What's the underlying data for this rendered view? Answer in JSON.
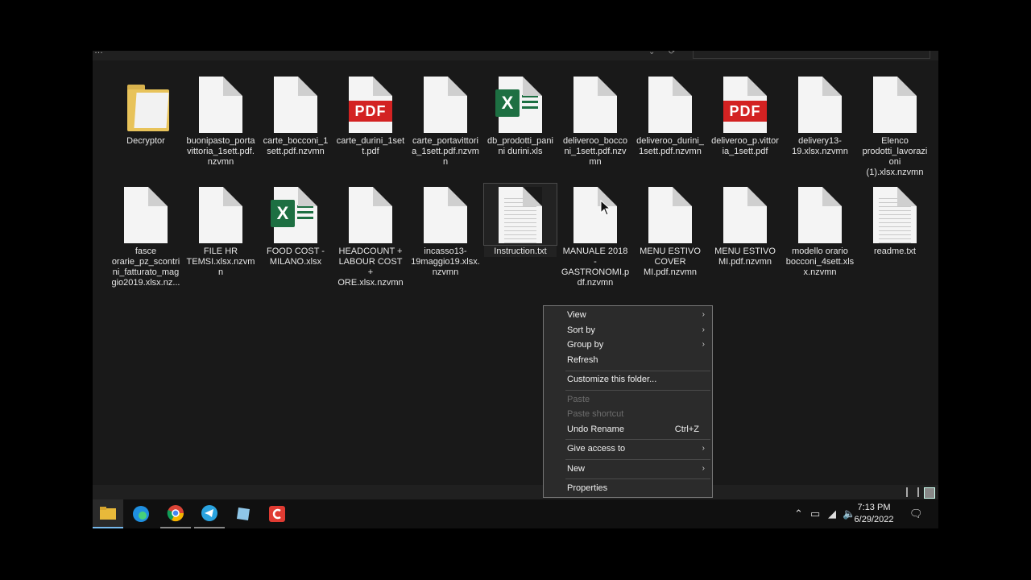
{
  "topbar": {
    "crumb": "…",
    "search_placeholder": "…"
  },
  "files": [
    {
      "name": "Decryptor",
      "kind": "folder"
    },
    {
      "name": "buonipasto_portavittoria_1sett.pdf.nzvmn",
      "kind": "blank"
    },
    {
      "name": "carte_bocconi_1sett.pdf.nzvmn",
      "kind": "blank"
    },
    {
      "name": "carte_durini_1sett.pdf",
      "kind": "pdf"
    },
    {
      "name": "carte_portavittoria_1sett.pdf.nzvmn",
      "kind": "blank"
    },
    {
      "name": "db_prodotti_panini durini.xls",
      "kind": "xls"
    },
    {
      "name": "deliveroo_bocconi_1sett.pdf.nzvmn",
      "kind": "blank"
    },
    {
      "name": "deliveroo_durini_1sett.pdf.nzvmn",
      "kind": "blank"
    },
    {
      "name": "deliveroo_p.vittoria_1sett.pdf",
      "kind": "pdf"
    },
    {
      "name": "delivery13-19.xlsx.nzvmn",
      "kind": "blank"
    },
    {
      "name": "Elenco prodotti_lavorazioni (1).xlsx.nzvmn",
      "kind": "blank"
    },
    {
      "name": "fasce orarie_pz_scontrini_fatturato_maggio2019.xlsx.nz...",
      "kind": "blank"
    },
    {
      "name": "FILE HR TEMSI.xlsx.nzvmn",
      "kind": "blank"
    },
    {
      "name": "FOOD COST - MILANO.xlsx",
      "kind": "xls"
    },
    {
      "name": "HEADCOUNT + LABOUR COST + ORE.xlsx.nzvmn",
      "kind": "blank"
    },
    {
      "name": "incasso13-19maggio19.xlsx.nzvmn",
      "kind": "blank"
    },
    {
      "name": "Instruction.txt",
      "kind": "txt",
      "selected": true
    },
    {
      "name": "MANUALE 2018 - GASTRONOMI.pdf.nzvmn",
      "kind": "blank"
    },
    {
      "name": "MENU ESTIVO COVER MI.pdf.nzvmn",
      "kind": "blank"
    },
    {
      "name": "MENU ESTIVO MI.pdf.nzvmn",
      "kind": "blank"
    },
    {
      "name": "modello orario bocconi_4sett.xlsx.nzvmn",
      "kind": "blank"
    },
    {
      "name": "readme.txt",
      "kind": "txt"
    }
  ],
  "context_menu": {
    "items": [
      {
        "label": "View",
        "submenu": true
      },
      {
        "label": "Sort by",
        "submenu": true
      },
      {
        "label": "Group by",
        "submenu": true
      },
      {
        "label": "Refresh"
      },
      {
        "label": "Customize this folder..."
      },
      {
        "label": "Paste",
        "disabled": true
      },
      {
        "label": "Paste shortcut",
        "disabled": true
      },
      {
        "label": "Undo Rename",
        "shortcut": "Ctrl+Z"
      },
      {
        "label": "Give access to",
        "submenu": true
      },
      {
        "label": "New",
        "submenu": true
      },
      {
        "label": "Properties"
      }
    ]
  },
  "taskbar": {
    "apps": [
      "file-explorer",
      "edge",
      "chrome",
      "telegram",
      "app-generic",
      "ccleaner"
    ],
    "clock_time": "7:13 PM",
    "clock_date": "6/29/2022"
  }
}
